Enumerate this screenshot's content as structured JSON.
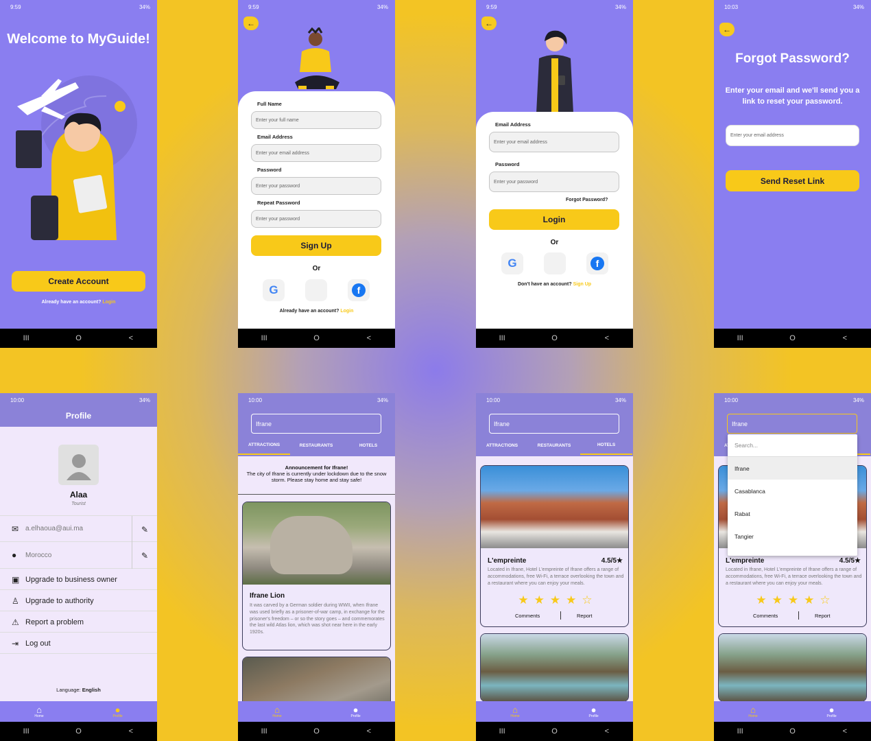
{
  "status": {
    "t1": "9:59",
    "t4": "10:03",
    "t5": "10:00",
    "batt": "34%"
  },
  "nav": {
    "recents": "III",
    "home": "O",
    "back": "<"
  },
  "welcome": {
    "title": "Welcome to MyGuide!",
    "create": "Create Account",
    "have": "Already have an account?",
    "login": "Login"
  },
  "signup": {
    "labels": [
      "Full Name",
      "Email Address",
      "Password",
      "Repeat Password"
    ],
    "placeholders": [
      "Enter your full name",
      "Enter your email address",
      "Enter your password",
      "Enter your password"
    ],
    "button": "Sign Up",
    "or": "Or",
    "have": "Already have an account?",
    "login": "Login"
  },
  "login": {
    "email_label": "Email Address",
    "email_ph": "Enter your email address",
    "pass_label": "Password",
    "pass_ph": "Enter your password",
    "forgot": "Forgot Password?",
    "button": "Login",
    "or": "Or",
    "dont": "Don't have an account?",
    "signup": "Sign Up"
  },
  "forgot": {
    "title": "Forgot Password?",
    "desc": "Enter your email and we'll send you a link to reset your password.",
    "ph": "Enter your email address",
    "button": "Send Reset Link"
  },
  "profile": {
    "title": "Profile",
    "name": "Alaa",
    "role": "Tourist",
    "email": "a.elhaoua@aui.ma",
    "country": "Morocco",
    "items": [
      "Upgrade to business owner",
      "Upgrade to authority",
      "Report a problem",
      "Log out"
    ],
    "lang_label": "Language:",
    "lang": "English"
  },
  "city": {
    "value": "Ifrane",
    "tabs": [
      "ATTRACTIONS",
      "RESTAURANTS",
      "HOTELS"
    ]
  },
  "attractions": {
    "ann_title": "Announcement for Ifrane!",
    "ann_text": "The city of Ifrane is currently under lockdown due to the snow storm. Please stay home and stay safe!",
    "card_title": "Ifrane Lion",
    "card_text": "It was carved by a German soldier during WWII, when Ifrane was used briefly as a prisoner-of-war camp, in exchange for the prisoner's freedom – or so the story goes – and commemorates the last wild Atlas lion, which was shot near here in the early 1920s."
  },
  "hotel": {
    "name": "L'empreinte",
    "rating": "4.5/5",
    "desc": "Located in Ifrane, Hotel L'empreinte of Ifrane offers a range of accommodations, free Wi-Fi, a terrace overlooking the town and a restaurant where you can enjoy your meals.",
    "comments": "Comments",
    "report": "Report",
    "stars": 4.5
  },
  "dropdown": {
    "search": "Search...",
    "options": [
      "Ifrane",
      "Casablanca",
      "Rabat",
      "Tangier"
    ]
  },
  "bottom": {
    "home": "Home",
    "profile": "Profile"
  }
}
